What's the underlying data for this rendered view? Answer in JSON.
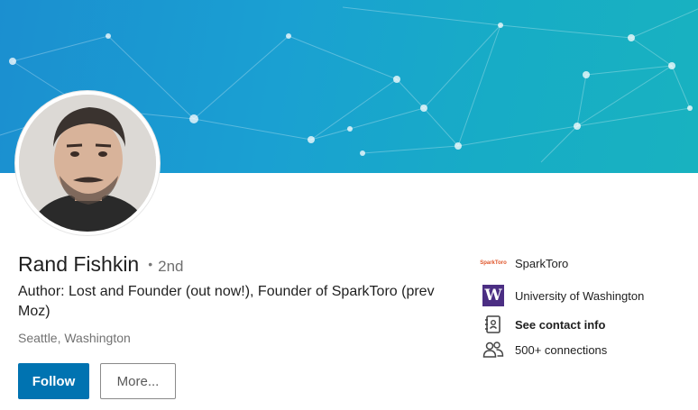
{
  "profile": {
    "name": "Rand Fishkin",
    "connection_separator": "•",
    "connection_degree": "2nd",
    "headline": "Author: Lost and Founder (out now!), Founder of SparkToro (prev Moz)",
    "location": "Seattle, Washington"
  },
  "actions": {
    "follow_label": "Follow",
    "more_label": "More..."
  },
  "sidebar": {
    "company": {
      "logo_text": "SparkToro",
      "label": "SparkToro"
    },
    "school": {
      "logo_text": "W",
      "label": "University of Washington"
    },
    "contact": {
      "label": "See contact info"
    },
    "connections": {
      "label": "500+ connections"
    }
  },
  "colors": {
    "banner_start": "#1b8fd0",
    "banner_end": "#18b2c0",
    "follow_button": "#0073b1",
    "uw_purple": "#4b2e83"
  },
  "icons": {
    "contact": "contact-card-icon",
    "connections": "people-icon"
  }
}
